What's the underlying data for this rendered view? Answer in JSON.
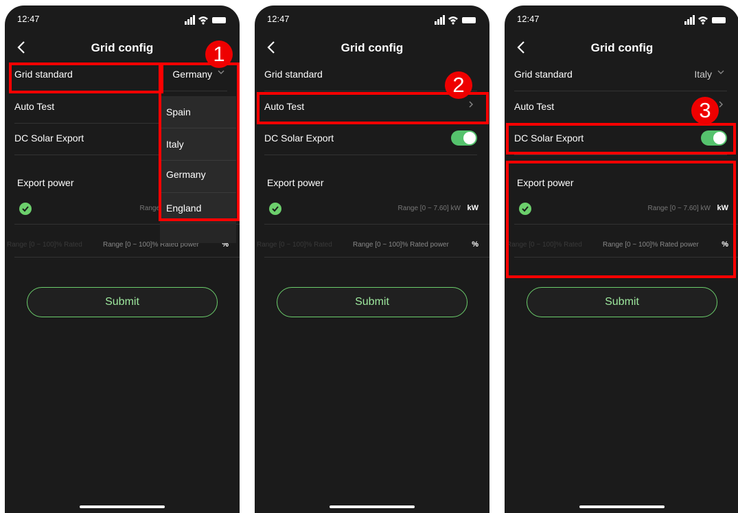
{
  "status": {
    "time": "12:47"
  },
  "nav": {
    "title": "Grid config"
  },
  "rows": {
    "grid_standard": "Grid standard",
    "auto_test": "Auto Test",
    "dc_solar_export": "DC Solar Export"
  },
  "export": {
    "title": "Export power",
    "kw_range": "Range [0 ~ 7.60] kW",
    "kw_range_partial": "Range",
    "kw_unit": "kW",
    "pct_range": "Range [0 ~ 100]% Rated power",
    "pct_range_ghost": "Range [0 ~ 100]% Rated",
    "pct_unit": "%"
  },
  "submit": "Submit",
  "phone1": {
    "selected": "Germany",
    "dropdown": [
      "Spain",
      "Italy",
      "Germany",
      "England"
    ],
    "badge": "1"
  },
  "phone2": {
    "badge": "2",
    "dc_solar_export_on": true
  },
  "phone3": {
    "selected": "Italy",
    "badge": "3",
    "dc_solar_export_on": true
  },
  "colors": {
    "accent": "#6ccf6c",
    "toggle": "#55c36d",
    "highlight": "#ff0000",
    "background": "#1b1b1b"
  }
}
